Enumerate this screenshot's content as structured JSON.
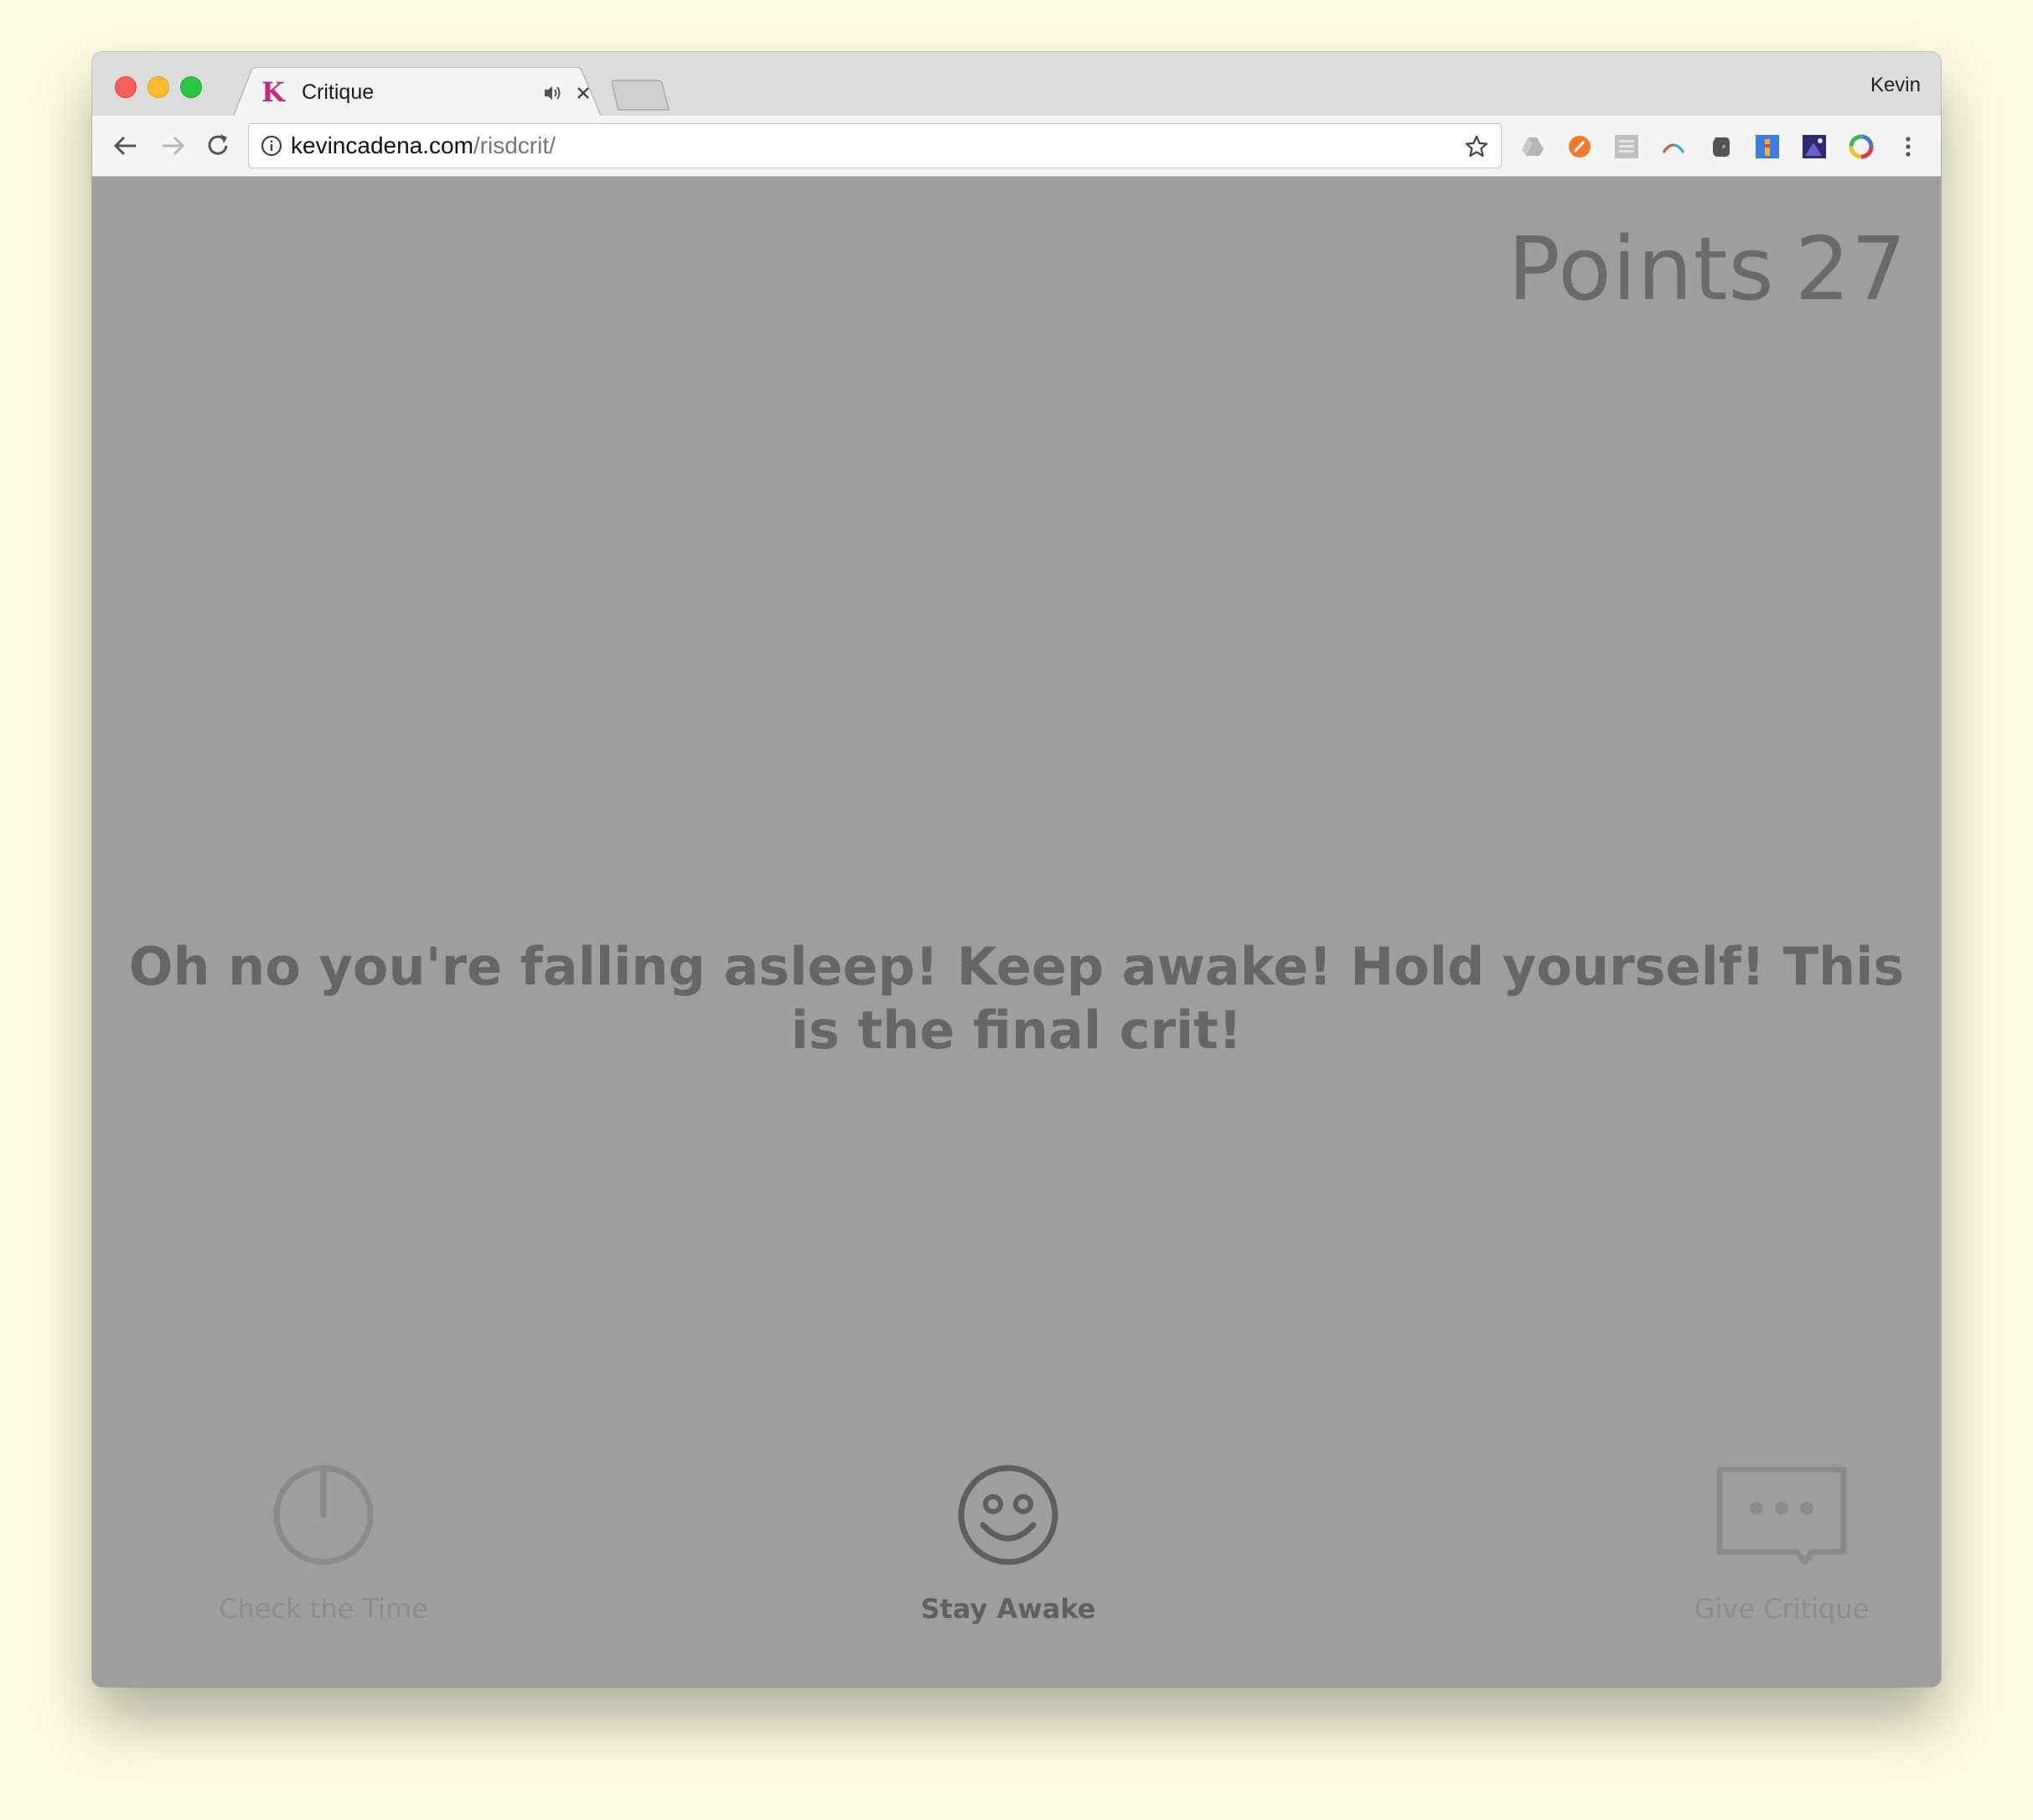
{
  "browser": {
    "tab": {
      "title": "Critique",
      "favicon_letter": "K"
    },
    "profile_name": "Kevin",
    "address": {
      "host": "kevincadena.com",
      "path": "/risdcrit/"
    },
    "extensions": [
      "google-drive-icon",
      "orange-circle-extension-icon",
      "code-extension-icon",
      "arc-extension-icon",
      "evernote-icon",
      "lighthouse-extension-icon",
      "night-sky-extension-icon",
      "color-wheel-extension-icon"
    ]
  },
  "game": {
    "points_label": "Points",
    "points_value": "27",
    "message": "Oh no you're falling asleep! Keep awake! Hold yourself! This is the final crit!",
    "actions": [
      {
        "label": "Check the Time",
        "icon": "clock-icon",
        "state": "disabled"
      },
      {
        "label": "Stay Awake",
        "icon": "smiley-icon",
        "state": "active"
      },
      {
        "label": "Give Critique",
        "icon": "speech-bubble-icon",
        "state": "disabled"
      }
    ]
  },
  "colors": {
    "page_background": "#9e9e9e",
    "primary_text": "#666666",
    "disabled_text": "#8c8c8c",
    "desktop_background": "#fdfbe0"
  }
}
